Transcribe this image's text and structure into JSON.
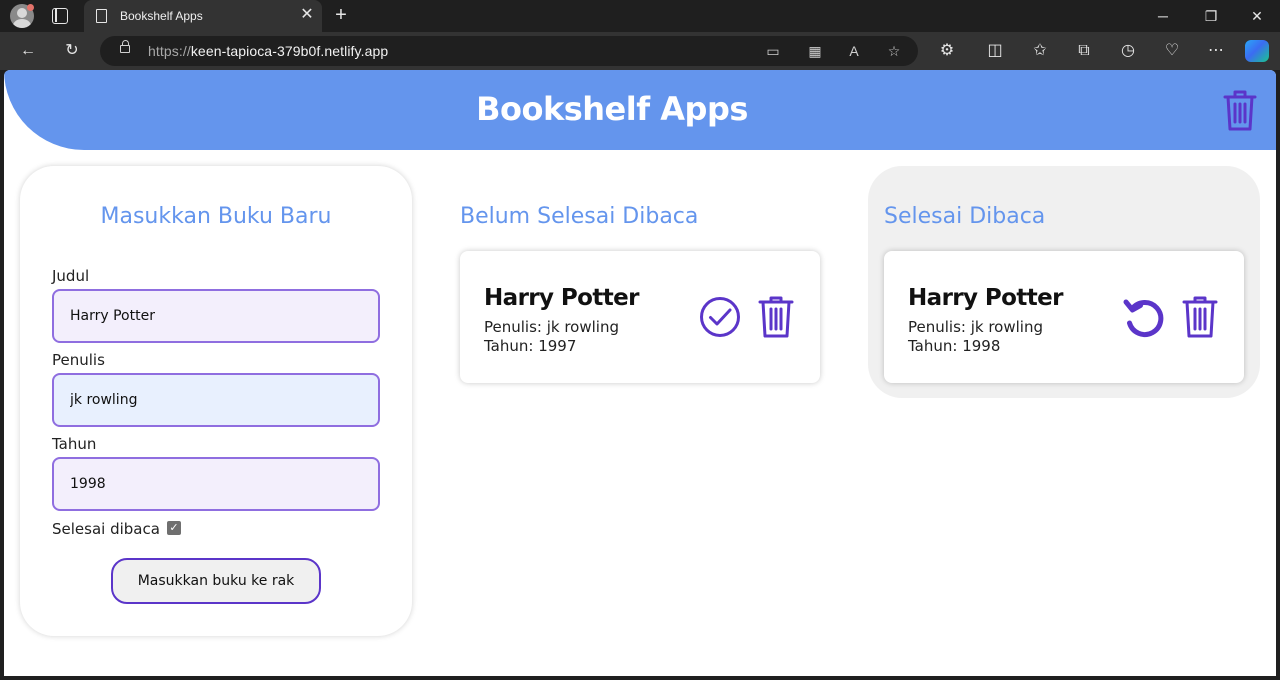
{
  "browser": {
    "tab_title": "Bookshelf Apps",
    "url_scheme": "https://",
    "url_host": "keen-tapioca-379b0f.netlify.app"
  },
  "header": {
    "title": "Bookshelf Apps"
  },
  "form": {
    "title": "Masukkan Buku Baru",
    "judul_label": "Judul",
    "judul_value": "Harry Potter",
    "penulis_label": "Penulis",
    "penulis_value": "jk rowling",
    "tahun_label": "Tahun",
    "tahun_value": "1998",
    "selesai_label": "Selesai dibaca",
    "selesai_checked": true,
    "submit_label": "Masukkan buku ke rak"
  },
  "shelves": {
    "unread": {
      "title": "Belum Selesai Dibaca",
      "books": [
        {
          "title": "Harry Potter",
          "author": "Penulis: jk rowling",
          "year": "Tahun: 1997"
        }
      ]
    },
    "read": {
      "title": "Selesai Dibaca",
      "books": [
        {
          "title": "Harry Potter",
          "author": "Penulis: jk rowling",
          "year": "Tahun: 1998"
        }
      ]
    }
  },
  "colors": {
    "accent": "#6495ed",
    "icon_purple": "#5b35c9",
    "input_border": "#8f6ee0"
  }
}
